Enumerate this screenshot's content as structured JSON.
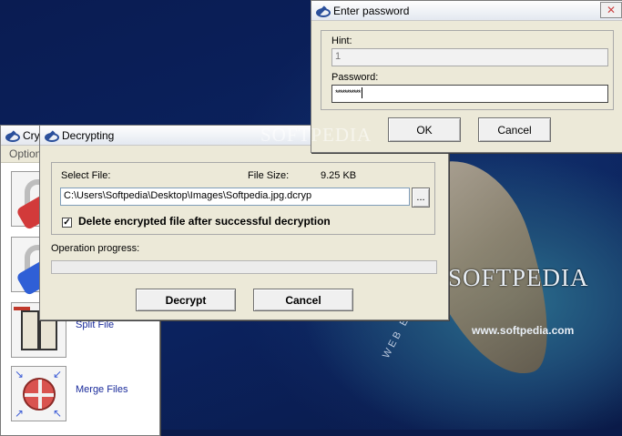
{
  "desktop": {
    "logo_text": "SOFTPEDIA",
    "url_text": "www.softpedia.com",
    "web_text": "WEB EN",
    "watermark": "SOFTPEDIA"
  },
  "main_window": {
    "title": "Cry",
    "menu_label": "Option",
    "tools": [
      {
        "label": ""
      },
      {
        "label": ""
      },
      {
        "label": "Split File"
      },
      {
        "label": "Merge Files"
      }
    ]
  },
  "decrypt_dialog": {
    "title": "Decrypting",
    "select_file_label": "Select File:",
    "file_size_label": "File Size:",
    "file_size_value": "9.25 KB",
    "file_path": "C:\\Users\\Softpedia\\Desktop\\Images\\Softpedia.jpg.dcryp",
    "browse_label": "...",
    "delete_checkbox_label": "Delete encrypted file after successful decryption",
    "delete_checkbox_checked": true,
    "progress_label": "Operation progress:",
    "progress_value": 0,
    "decrypt_button": "Decrypt",
    "cancel_button": "Cancel"
  },
  "password_dialog": {
    "title": "Enter password",
    "close_label": "✕",
    "hint_label": "Hint:",
    "hint_value": "1",
    "password_label": "Password:",
    "password_value": "***********",
    "ok_button": "OK",
    "cancel_button": "Cancel"
  },
  "colors": {
    "accent": "#2a4f9b",
    "link": "#1a2b9b",
    "lock_red": "#d23a3a",
    "lock_blue": "#2f5fd6"
  }
}
